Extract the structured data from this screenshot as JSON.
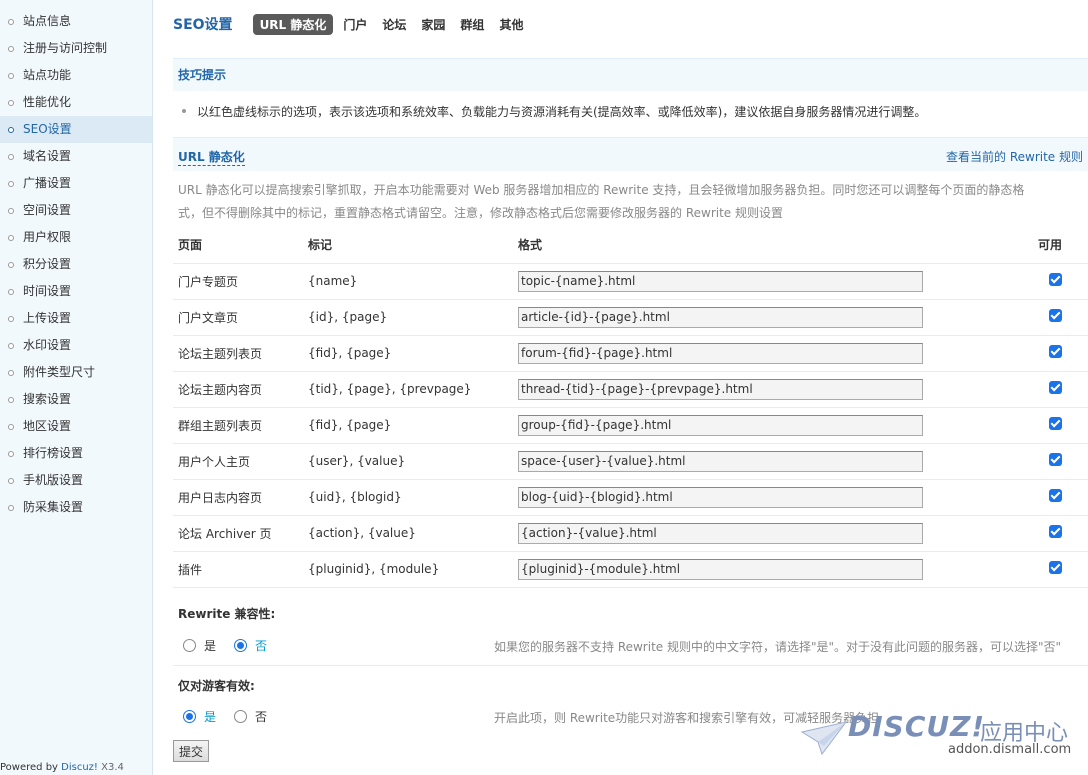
{
  "sidebar": {
    "items": [
      {
        "label": "站点信息"
      },
      {
        "label": "注册与访问控制"
      },
      {
        "label": "站点功能"
      },
      {
        "label": "性能优化"
      },
      {
        "label": "SEO设置"
      },
      {
        "label": "域名设置"
      },
      {
        "label": "广播设置"
      },
      {
        "label": "空间设置"
      },
      {
        "label": "用户权限"
      },
      {
        "label": "积分设置"
      },
      {
        "label": "时间设置"
      },
      {
        "label": "上传设置"
      },
      {
        "label": "水印设置"
      },
      {
        "label": "附件类型尺寸"
      },
      {
        "label": "搜索设置"
      },
      {
        "label": "地区设置"
      },
      {
        "label": "排行榜设置"
      },
      {
        "label": "手机版设置"
      },
      {
        "label": "防采集设置"
      }
    ],
    "active_index": 4,
    "powered_prefix": "Powered by ",
    "powered_brand": "Discuz!",
    "powered_version": " X3.4"
  },
  "header": {
    "title": "SEO设置",
    "tabs": [
      "URL 静态化",
      "门户",
      "论坛",
      "家园",
      "群组",
      "其他"
    ],
    "active_tab": 0
  },
  "tips": {
    "title": "技巧提示",
    "text": "以红色虚线标示的选项，表示该选项和系统效率、负载能力与资源消耗有关(提高效率、或降低效率)，建议依据自身服务器情况进行调整。"
  },
  "section": {
    "title": "URL 静态化",
    "rules_link": "查看当前的 Rewrite 规则",
    "description": "URL 静态化可以提高搜索引擎抓取，开启本功能需要对 Web 服务器增加相应的 Rewrite 支持，且会轻微增加服务器负担。同时您还可以调整每个页面的静态格式，但不得删除其中的标记，重置静态格式请留空。注意，修改静态格式后您需要修改服务器的 Rewrite 规则设置"
  },
  "table": {
    "headers": [
      "页面",
      "标记",
      "格式",
      "可用"
    ],
    "rows": [
      {
        "page": "门户专题页",
        "tags": "{name}",
        "format": "topic-{name}.html",
        "enabled": true
      },
      {
        "page": "门户文章页",
        "tags": "{id}, {page}",
        "format": "article-{id}-{page}.html",
        "enabled": true
      },
      {
        "page": "论坛主题列表页",
        "tags": "{fid}, {page}",
        "format": "forum-{fid}-{page}.html",
        "enabled": true
      },
      {
        "page": "论坛主题内容页",
        "tags": "{tid}, {page}, {prevpage}",
        "format": "thread-{tid}-{page}-{prevpage}.html",
        "enabled": true
      },
      {
        "page": "群组主题列表页",
        "tags": "{fid}, {page}",
        "format": "group-{fid}-{page}.html",
        "enabled": true
      },
      {
        "page": "用户个人主页",
        "tags": "{user}, {value}",
        "format": "space-{user}-{value}.html",
        "enabled": true
      },
      {
        "page": "用户日志内容页",
        "tags": "{uid}, {blogid}",
        "format": "blog-{uid}-{blogid}.html",
        "enabled": true
      },
      {
        "page": "论坛 Archiver 页",
        "tags": "{action}, {value}",
        "format": "{action}-{value}.html",
        "enabled": true
      },
      {
        "page": "插件",
        "tags": "{pluginid}, {module}",
        "format": "{pluginid}-{module}.html",
        "enabled": true
      }
    ]
  },
  "rewrite_compat": {
    "title": "Rewrite 兼容性:",
    "yes": "是",
    "no": "否",
    "selected": "no",
    "tip": "如果您的服务器不支持 Rewrite 规则中的中文字符，请选择\"是\"。对于没有此问题的服务器，可以选择\"否\""
  },
  "guest_only": {
    "title": "仅对游客有效:",
    "yes": "是",
    "no": "否",
    "selected": "yes",
    "tip": "开启此项，则 Rewrite功能只对游客和搜索引擎有效，可减轻服务器负担"
  },
  "submit_label": "提交",
  "watermark": {
    "logo": "DISCUZ!",
    "cn": "应用中心",
    "url": "addon.dismall.com"
  },
  "colors": {
    "accent": "#2366a8",
    "checkbox": "#1a73e8",
    "sidebar_bg": "#f2f9fd"
  }
}
